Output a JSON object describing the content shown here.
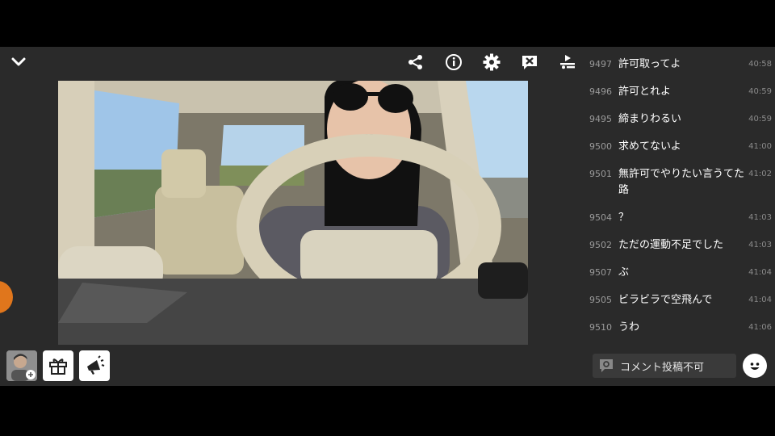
{
  "toolbar": {
    "collapse_icon": "chevron-down-icon",
    "icons": [
      "share-icon",
      "info-icon",
      "gear-icon",
      "close-box-icon",
      "cast-icon"
    ]
  },
  "comments": [
    {
      "num": "9497",
      "text": "許可取ってよ",
      "time": "40:58"
    },
    {
      "num": "9496",
      "text": "許可とれよ",
      "time": "40:59"
    },
    {
      "num": "9495",
      "text": "締まりわるい",
      "time": "40:59"
    },
    {
      "num": "9500",
      "text": "求めてないよ",
      "time": "41:00"
    },
    {
      "num": "9501",
      "text": "無許可でやりたい言うてた路",
      "time": "41:02"
    },
    {
      "num": "9504",
      "text": "？",
      "time": "41:03"
    },
    {
      "num": "9502",
      "text": "ただの運動不足でした",
      "time": "41:03"
    },
    {
      "num": "9507",
      "text": "ぶ",
      "time": "41:04"
    },
    {
      "num": "9505",
      "text": "ビラビラで空飛んで",
      "time": "41:04"
    },
    {
      "num": "9510",
      "text": "うわ",
      "time": "41:06"
    }
  ],
  "comment_input": {
    "placeholder": "コメント投稿不可"
  },
  "colors": {
    "accent": "#e0761c",
    "panel": "#2a2a2a"
  }
}
